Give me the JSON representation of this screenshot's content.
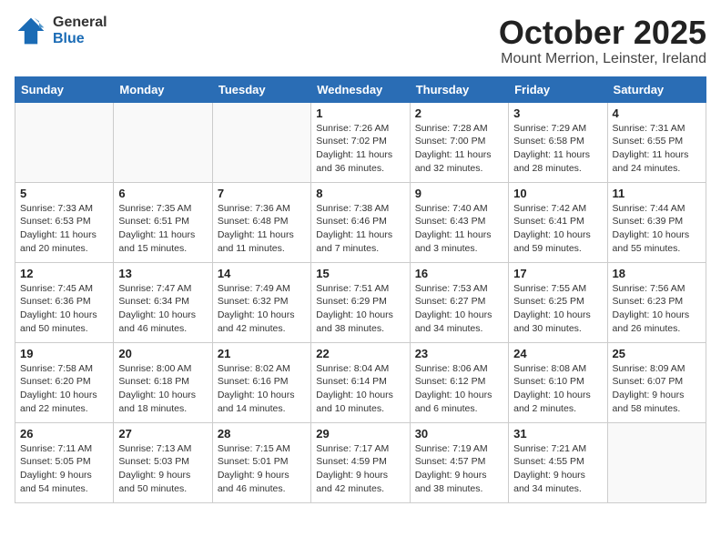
{
  "logo": {
    "general": "General",
    "blue": "Blue"
  },
  "title": "October 2025",
  "location": "Mount Merrion, Leinster, Ireland",
  "weekdays": [
    "Sunday",
    "Monday",
    "Tuesday",
    "Wednesday",
    "Thursday",
    "Friday",
    "Saturday"
  ],
  "weeks": [
    [
      {
        "day": "",
        "info": ""
      },
      {
        "day": "",
        "info": ""
      },
      {
        "day": "",
        "info": ""
      },
      {
        "day": "1",
        "info": "Sunrise: 7:26 AM\nSunset: 7:02 PM\nDaylight: 11 hours\nand 36 minutes."
      },
      {
        "day": "2",
        "info": "Sunrise: 7:28 AM\nSunset: 7:00 PM\nDaylight: 11 hours\nand 32 minutes."
      },
      {
        "day": "3",
        "info": "Sunrise: 7:29 AM\nSunset: 6:58 PM\nDaylight: 11 hours\nand 28 minutes."
      },
      {
        "day": "4",
        "info": "Sunrise: 7:31 AM\nSunset: 6:55 PM\nDaylight: 11 hours\nand 24 minutes."
      }
    ],
    [
      {
        "day": "5",
        "info": "Sunrise: 7:33 AM\nSunset: 6:53 PM\nDaylight: 11 hours\nand 20 minutes."
      },
      {
        "day": "6",
        "info": "Sunrise: 7:35 AM\nSunset: 6:51 PM\nDaylight: 11 hours\nand 15 minutes."
      },
      {
        "day": "7",
        "info": "Sunrise: 7:36 AM\nSunset: 6:48 PM\nDaylight: 11 hours\nand 11 minutes."
      },
      {
        "day": "8",
        "info": "Sunrise: 7:38 AM\nSunset: 6:46 PM\nDaylight: 11 hours\nand 7 minutes."
      },
      {
        "day": "9",
        "info": "Sunrise: 7:40 AM\nSunset: 6:43 PM\nDaylight: 11 hours\nand 3 minutes."
      },
      {
        "day": "10",
        "info": "Sunrise: 7:42 AM\nSunset: 6:41 PM\nDaylight: 10 hours\nand 59 minutes."
      },
      {
        "day": "11",
        "info": "Sunrise: 7:44 AM\nSunset: 6:39 PM\nDaylight: 10 hours\nand 55 minutes."
      }
    ],
    [
      {
        "day": "12",
        "info": "Sunrise: 7:45 AM\nSunset: 6:36 PM\nDaylight: 10 hours\nand 50 minutes."
      },
      {
        "day": "13",
        "info": "Sunrise: 7:47 AM\nSunset: 6:34 PM\nDaylight: 10 hours\nand 46 minutes."
      },
      {
        "day": "14",
        "info": "Sunrise: 7:49 AM\nSunset: 6:32 PM\nDaylight: 10 hours\nand 42 minutes."
      },
      {
        "day": "15",
        "info": "Sunrise: 7:51 AM\nSunset: 6:29 PM\nDaylight: 10 hours\nand 38 minutes."
      },
      {
        "day": "16",
        "info": "Sunrise: 7:53 AM\nSunset: 6:27 PM\nDaylight: 10 hours\nand 34 minutes."
      },
      {
        "day": "17",
        "info": "Sunrise: 7:55 AM\nSunset: 6:25 PM\nDaylight: 10 hours\nand 30 minutes."
      },
      {
        "day": "18",
        "info": "Sunrise: 7:56 AM\nSunset: 6:23 PM\nDaylight: 10 hours\nand 26 minutes."
      }
    ],
    [
      {
        "day": "19",
        "info": "Sunrise: 7:58 AM\nSunset: 6:20 PM\nDaylight: 10 hours\nand 22 minutes."
      },
      {
        "day": "20",
        "info": "Sunrise: 8:00 AM\nSunset: 6:18 PM\nDaylight: 10 hours\nand 18 minutes."
      },
      {
        "day": "21",
        "info": "Sunrise: 8:02 AM\nSunset: 6:16 PM\nDaylight: 10 hours\nand 14 minutes."
      },
      {
        "day": "22",
        "info": "Sunrise: 8:04 AM\nSunset: 6:14 PM\nDaylight: 10 hours\nand 10 minutes."
      },
      {
        "day": "23",
        "info": "Sunrise: 8:06 AM\nSunset: 6:12 PM\nDaylight: 10 hours\nand 6 minutes."
      },
      {
        "day": "24",
        "info": "Sunrise: 8:08 AM\nSunset: 6:10 PM\nDaylight: 10 hours\nand 2 minutes."
      },
      {
        "day": "25",
        "info": "Sunrise: 8:09 AM\nSunset: 6:07 PM\nDaylight: 9 hours\nand 58 minutes."
      }
    ],
    [
      {
        "day": "26",
        "info": "Sunrise: 7:11 AM\nSunset: 5:05 PM\nDaylight: 9 hours\nand 54 minutes."
      },
      {
        "day": "27",
        "info": "Sunrise: 7:13 AM\nSunset: 5:03 PM\nDaylight: 9 hours\nand 50 minutes."
      },
      {
        "day": "28",
        "info": "Sunrise: 7:15 AM\nSunset: 5:01 PM\nDaylight: 9 hours\nand 46 minutes."
      },
      {
        "day": "29",
        "info": "Sunrise: 7:17 AM\nSunset: 4:59 PM\nDaylight: 9 hours\nand 42 minutes."
      },
      {
        "day": "30",
        "info": "Sunrise: 7:19 AM\nSunset: 4:57 PM\nDaylight: 9 hours\nand 38 minutes."
      },
      {
        "day": "31",
        "info": "Sunrise: 7:21 AM\nSunset: 4:55 PM\nDaylight: 9 hours\nand 34 minutes."
      },
      {
        "day": "",
        "info": ""
      }
    ]
  ]
}
